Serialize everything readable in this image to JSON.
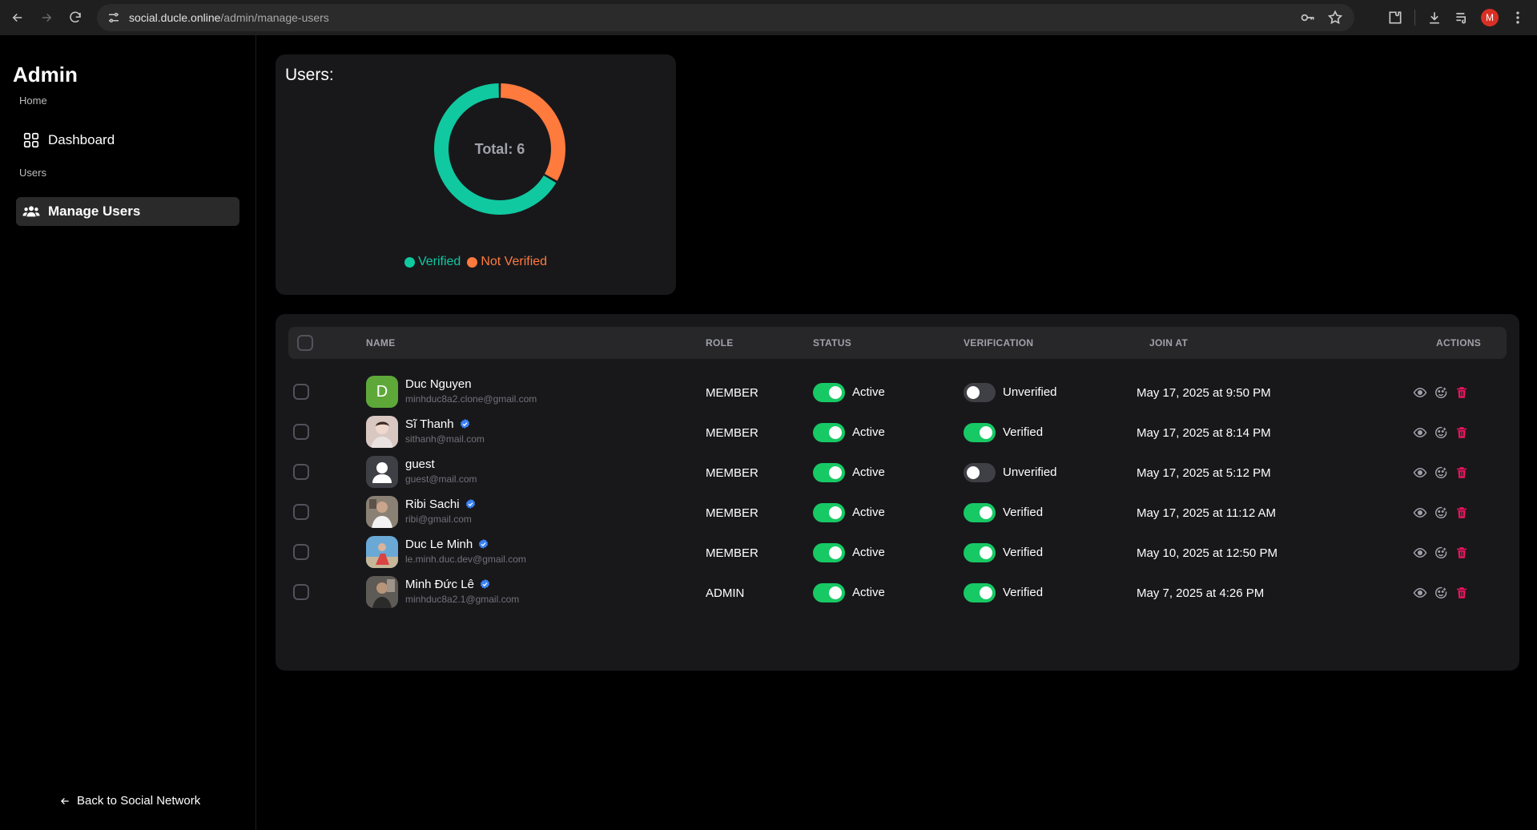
{
  "browser": {
    "url_host": "social.ducle.online",
    "url_path": "/admin/manage-users",
    "profile_initial": "M"
  },
  "sidebar": {
    "title": "Admin",
    "section_home": "Home",
    "dashboard_label": "Dashboard",
    "section_users": "Users",
    "manage_users_label": "Manage Users",
    "back_label": "Back to Social Network"
  },
  "users_card": {
    "title": "Users:",
    "total_label": "Total: 6",
    "legend_verified": "Verified",
    "legend_not_verified": "Not Verified"
  },
  "chart_data": {
    "type": "pie",
    "categories": [
      "Verified",
      "Not Verified"
    ],
    "values": [
      4,
      2
    ],
    "colors": [
      "#10c9a0",
      "#ff7a3d"
    ],
    "center_label": "Total: 6"
  },
  "table": {
    "headers": {
      "name": "NAME",
      "role": "ROLE",
      "status": "STATUS",
      "verification": "VERIFICATION",
      "join": "JOIN AT",
      "actions": "ACTIONS"
    },
    "rows": [
      {
        "name": "Duc Nguyen",
        "email": "minhduc8a2.clone@gmail.com",
        "verified_badge": false,
        "avatar": "letter",
        "avatar_letter": "D",
        "role": "MEMBER",
        "status": "Active",
        "status_on": true,
        "verification": "Unverified",
        "verification_on": false,
        "join": "May 17, 2025 at 9:50 PM"
      },
      {
        "name": "Sĩ Thanh",
        "email": "sithanh@mail.com",
        "verified_badge": true,
        "avatar": "photo",
        "role": "MEMBER",
        "status": "Active",
        "status_on": true,
        "verification": "Verified",
        "verification_on": true,
        "join": "May 17, 2025 at 8:14 PM"
      },
      {
        "name": "guest",
        "email": "guest@mail.com",
        "verified_badge": false,
        "avatar": "default",
        "role": "MEMBER",
        "status": "Active",
        "status_on": true,
        "verification": "Unverified",
        "verification_on": false,
        "join": "May 17, 2025 at 5:12 PM"
      },
      {
        "name": "Ribi Sachi",
        "email": "ribi@gmail.com",
        "verified_badge": true,
        "avatar": "photo",
        "role": "MEMBER",
        "status": "Active",
        "status_on": true,
        "verification": "Verified",
        "verification_on": true,
        "join": "May 17, 2025 at 11:12 AM"
      },
      {
        "name": "Duc Le Minh",
        "email": "le.minh.duc.dev@gmail.com",
        "verified_badge": true,
        "avatar": "photo",
        "role": "MEMBER",
        "status": "Active",
        "status_on": true,
        "verification": "Verified",
        "verification_on": true,
        "join": "May 10, 2025 at 12:50 PM"
      },
      {
        "name": "Minh Đức Lê",
        "email": "minhduc8a2.1@gmail.com",
        "verified_badge": true,
        "avatar": "photo",
        "role": "ADMIN",
        "status": "Active",
        "status_on": true,
        "verification": "Verified",
        "verification_on": true,
        "join": "May 7, 2025 at 4:26 PM"
      }
    ]
  },
  "colors": {
    "accent_green": "#17c964",
    "verified_teal": "#10c9a0",
    "not_verified_orange": "#ff7a3d",
    "delete_red": "#f31260",
    "badge_blue": "#3b82f6"
  }
}
